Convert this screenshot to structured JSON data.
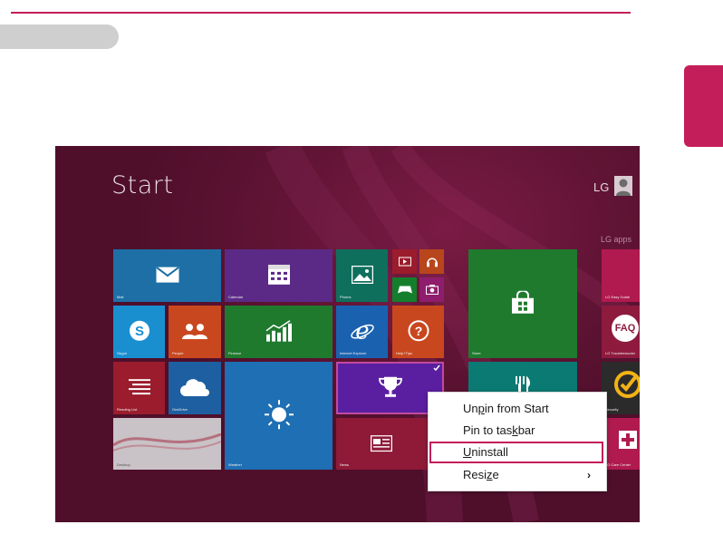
{
  "screen": {
    "title": "Start",
    "user": "LG",
    "group_label": "LG apps"
  },
  "tiles": {
    "mail": "Mail",
    "calendar": "Calendar",
    "photos": "Photos",
    "skype": "Skype",
    "people": "People",
    "finance": "Finance",
    "internet_explorer": "Internet Explorer",
    "help_tips": "Help+Tips",
    "store": "Store",
    "reading_list": "Reading List",
    "onedrive": "OneDrive",
    "weather": "Weather",
    "news": "News",
    "desktop": "Desktop",
    "lg_easy_guide": "LG Easy Guide",
    "lg_troubleshooter": "LG Troubleshooter",
    "security": "Security",
    "lg_care_center": "LG Care Center",
    "faq_text": "FAQ"
  },
  "context_menu": {
    "unpin": {
      "pre": "Un",
      "acc": "p",
      "post": "in from Start"
    },
    "pin_taskbar": {
      "pre": "Pin to tas",
      "acc": "k",
      "post": "bar"
    },
    "uninstall": {
      "pre": "",
      "acc": "U",
      "post": "ninstall"
    },
    "resize": {
      "pre": "Resi",
      "acc": "z",
      "post": "e"
    },
    "resize_arrow": "›"
  },
  "colors": {
    "accent": "#c41e5a",
    "start_background": "#5a1231"
  }
}
